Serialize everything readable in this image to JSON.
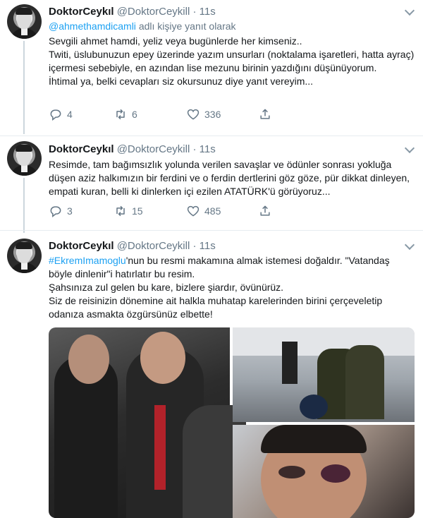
{
  "colors": {
    "accent": "#1da1f2",
    "text": "#14171a",
    "muted": "#657786",
    "border": "#e6ecf0"
  },
  "tweets": [
    {
      "display_name": "DoktorCeykıl",
      "handle": "@DoktorCeykill",
      "dot": "·",
      "time": "11s",
      "reply_handle": "@ahmethamdicamli",
      "reply_suffix": "adlı kişiye yanıt olarak",
      "paragraphs": [
        "Sevgili ahmet hamdi, yeliz veya bugünlerde her kimseniz..",
        "Twiti, üslubunuzun epey üzerinde yazım unsurları (noktalama işaretleri, hatta ayraç) içermesi sebebiyle, en azından lise mezunu birinin yazdığını düşünüyorum.",
        "İhtimal ya, belki cevapları siz okursunuz diye yanıt vereyim..."
      ],
      "replies": "4",
      "retweets": "6",
      "likes": "336"
    },
    {
      "display_name": "DoktorCeykıl",
      "handle": "@DoktorCeykill",
      "dot": "·",
      "time": "11s",
      "paragraphs": [
        "Resimde, tam bağımsızlık yolunda verilen savaşlar ve ödünler sonrası yokluğa düşen aziz halkımızın bir ferdini ve o ferdin dertlerini göz göze, pür dikkat dinleyen, empati kuran, belli ki dinlerken içi ezilen ATATÜRK'ü görüyoruz..."
      ],
      "replies": "3",
      "retweets": "15",
      "likes": "485"
    },
    {
      "display_name": "DoktorCeykıl",
      "handle": "@DoktorCeykill",
      "dot": "·",
      "time": "11s",
      "hashtag": "#EkremImamoglu",
      "line1_rest": "'nun bu resmi makamına almak istemesi doğaldır. \"Vatandaş böyle dinlenir\"i hatırlatır bu resim.",
      "paragraphs": [
        "Şahsınıza zul gelen bu kare, bizlere şiardır, övünürüz.",
        "Siz de reisinizin dönemine ait halkla muhatap karelerinden birini çerçeveletip odanıza asmakta özgürsünüz elbette!"
      ]
    }
  ],
  "icons": {
    "reply": "reply-icon",
    "retweet": "retweet-icon",
    "like": "heart-icon",
    "share": "share-icon",
    "more": "chevron-down-icon"
  }
}
